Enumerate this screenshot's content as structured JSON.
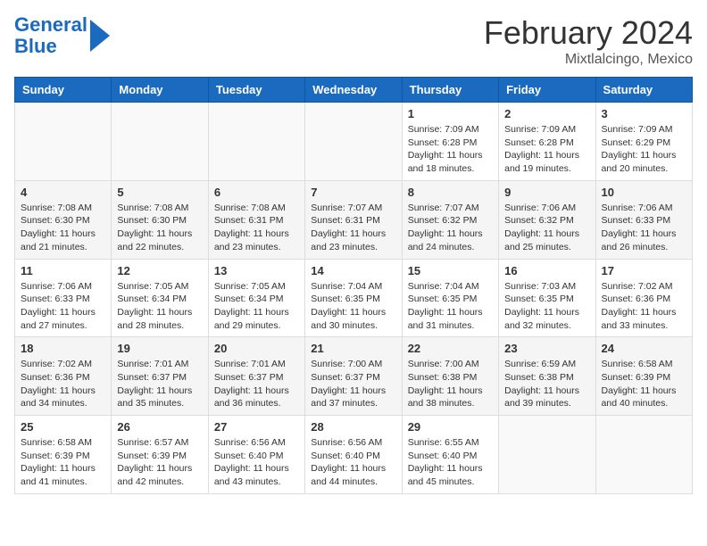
{
  "header": {
    "logo_line1": "General",
    "logo_line2": "Blue",
    "main_title": "February 2024",
    "subtitle": "Mixtlalcingo, Mexico"
  },
  "calendar": {
    "days_of_week": [
      "Sunday",
      "Monday",
      "Tuesday",
      "Wednesday",
      "Thursday",
      "Friday",
      "Saturday"
    ],
    "weeks": [
      {
        "even": false,
        "days": [
          {
            "num": "",
            "info": ""
          },
          {
            "num": "",
            "info": ""
          },
          {
            "num": "",
            "info": ""
          },
          {
            "num": "",
            "info": ""
          },
          {
            "num": "1",
            "info": "Sunrise: 7:09 AM\nSunset: 6:28 PM\nDaylight: 11 hours\nand 18 minutes."
          },
          {
            "num": "2",
            "info": "Sunrise: 7:09 AM\nSunset: 6:28 PM\nDaylight: 11 hours\nand 19 minutes."
          },
          {
            "num": "3",
            "info": "Sunrise: 7:09 AM\nSunset: 6:29 PM\nDaylight: 11 hours\nand 20 minutes."
          }
        ]
      },
      {
        "even": true,
        "days": [
          {
            "num": "4",
            "info": "Sunrise: 7:08 AM\nSunset: 6:30 PM\nDaylight: 11 hours\nand 21 minutes."
          },
          {
            "num": "5",
            "info": "Sunrise: 7:08 AM\nSunset: 6:30 PM\nDaylight: 11 hours\nand 22 minutes."
          },
          {
            "num": "6",
            "info": "Sunrise: 7:08 AM\nSunset: 6:31 PM\nDaylight: 11 hours\nand 23 minutes."
          },
          {
            "num": "7",
            "info": "Sunrise: 7:07 AM\nSunset: 6:31 PM\nDaylight: 11 hours\nand 23 minutes."
          },
          {
            "num": "8",
            "info": "Sunrise: 7:07 AM\nSunset: 6:32 PM\nDaylight: 11 hours\nand 24 minutes."
          },
          {
            "num": "9",
            "info": "Sunrise: 7:06 AM\nSunset: 6:32 PM\nDaylight: 11 hours\nand 25 minutes."
          },
          {
            "num": "10",
            "info": "Sunrise: 7:06 AM\nSunset: 6:33 PM\nDaylight: 11 hours\nand 26 minutes."
          }
        ]
      },
      {
        "even": false,
        "days": [
          {
            "num": "11",
            "info": "Sunrise: 7:06 AM\nSunset: 6:33 PM\nDaylight: 11 hours\nand 27 minutes."
          },
          {
            "num": "12",
            "info": "Sunrise: 7:05 AM\nSunset: 6:34 PM\nDaylight: 11 hours\nand 28 minutes."
          },
          {
            "num": "13",
            "info": "Sunrise: 7:05 AM\nSunset: 6:34 PM\nDaylight: 11 hours\nand 29 minutes."
          },
          {
            "num": "14",
            "info": "Sunrise: 7:04 AM\nSunset: 6:35 PM\nDaylight: 11 hours\nand 30 minutes."
          },
          {
            "num": "15",
            "info": "Sunrise: 7:04 AM\nSunset: 6:35 PM\nDaylight: 11 hours\nand 31 minutes."
          },
          {
            "num": "16",
            "info": "Sunrise: 7:03 AM\nSunset: 6:35 PM\nDaylight: 11 hours\nand 32 minutes."
          },
          {
            "num": "17",
            "info": "Sunrise: 7:02 AM\nSunset: 6:36 PM\nDaylight: 11 hours\nand 33 minutes."
          }
        ]
      },
      {
        "even": true,
        "days": [
          {
            "num": "18",
            "info": "Sunrise: 7:02 AM\nSunset: 6:36 PM\nDaylight: 11 hours\nand 34 minutes."
          },
          {
            "num": "19",
            "info": "Sunrise: 7:01 AM\nSunset: 6:37 PM\nDaylight: 11 hours\nand 35 minutes."
          },
          {
            "num": "20",
            "info": "Sunrise: 7:01 AM\nSunset: 6:37 PM\nDaylight: 11 hours\nand 36 minutes."
          },
          {
            "num": "21",
            "info": "Sunrise: 7:00 AM\nSunset: 6:37 PM\nDaylight: 11 hours\nand 37 minutes."
          },
          {
            "num": "22",
            "info": "Sunrise: 7:00 AM\nSunset: 6:38 PM\nDaylight: 11 hours\nand 38 minutes."
          },
          {
            "num": "23",
            "info": "Sunrise: 6:59 AM\nSunset: 6:38 PM\nDaylight: 11 hours\nand 39 minutes."
          },
          {
            "num": "24",
            "info": "Sunrise: 6:58 AM\nSunset: 6:39 PM\nDaylight: 11 hours\nand 40 minutes."
          }
        ]
      },
      {
        "even": false,
        "days": [
          {
            "num": "25",
            "info": "Sunrise: 6:58 AM\nSunset: 6:39 PM\nDaylight: 11 hours\nand 41 minutes."
          },
          {
            "num": "26",
            "info": "Sunrise: 6:57 AM\nSunset: 6:39 PM\nDaylight: 11 hours\nand 42 minutes."
          },
          {
            "num": "27",
            "info": "Sunrise: 6:56 AM\nSunset: 6:40 PM\nDaylight: 11 hours\nand 43 minutes."
          },
          {
            "num": "28",
            "info": "Sunrise: 6:56 AM\nSunset: 6:40 PM\nDaylight: 11 hours\nand 44 minutes."
          },
          {
            "num": "29",
            "info": "Sunrise: 6:55 AM\nSunset: 6:40 PM\nDaylight: 11 hours\nand 45 minutes."
          },
          {
            "num": "",
            "info": ""
          },
          {
            "num": "",
            "info": ""
          }
        ]
      }
    ]
  }
}
